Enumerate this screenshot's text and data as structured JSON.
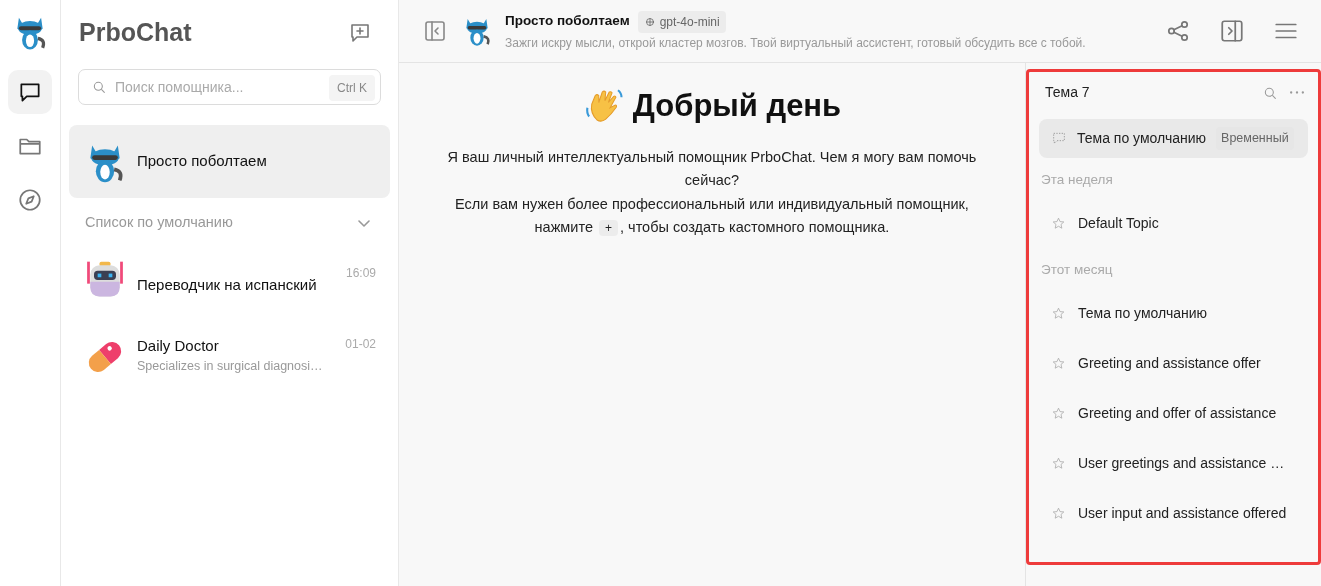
{
  "rail": {
    "items": [
      {
        "kind": "chat",
        "selected": true
      },
      {
        "kind": "folder",
        "selected": false
      },
      {
        "kind": "discover",
        "selected": false
      }
    ]
  },
  "sidebar": {
    "title": "PrboChat",
    "search": {
      "placeholder": "Поиск помощника...",
      "shortcut": "Ctrl K"
    },
    "pinned": {
      "name": "Просто поболтаем",
      "selected": true
    },
    "group": {
      "label": "Список по умолчанию",
      "expanded": true
    },
    "assistants": [
      {
        "name": "Переводчик на испанский",
        "time": "16:09",
        "kind": "robot",
        "selected": false
      },
      {
        "name": "Daily Doctor",
        "time": "01-02",
        "description": "Specializes in surgical diagnosi…",
        "kind": "pill",
        "selected": false
      }
    ]
  },
  "header": {
    "name": "Просто поболтаем",
    "model": "gpt-4o-mini",
    "description": "Зажги искру мысли, открой кластер мозгов. Твой виртуальный ассистент, готовый обсудить все с тобой."
  },
  "welcome": {
    "title": "Добрый день",
    "line1": "Я ваш личный интеллектуальный помощник PrboChat. Чем я могу вам помочь сейчас?",
    "line2": "Если вам нужен более профессиональный или индивидуальный помощник,",
    "line3_before": "нажмите",
    "key": "+",
    "line3_after": ", чтобы создать кастомного помощника."
  },
  "topics": {
    "title": "Тема 7",
    "highlighted": true,
    "current": {
      "title": "Тема по умолчанию",
      "badge": "Временный",
      "selected": true
    },
    "groups": [
      {
        "label": "Эта неделя",
        "items": [
          {
            "title": "Default Topic",
            "starred": false,
            "selected": false
          }
        ]
      },
      {
        "label": "Этот месяц",
        "items": [
          {
            "title": "Тема по умолчанию",
            "starred": false,
            "selected": false
          },
          {
            "title": "Greeting and assistance offer",
            "starred": false,
            "selected": false
          },
          {
            "title": "Greeting and offer of assistance",
            "starred": false,
            "selected": false
          },
          {
            "title": "User greetings and assistance …",
            "starred": false,
            "selected": false
          },
          {
            "title": "User input and assistance offered",
            "starred": false,
            "selected": false
          }
        ]
      }
    ]
  }
}
